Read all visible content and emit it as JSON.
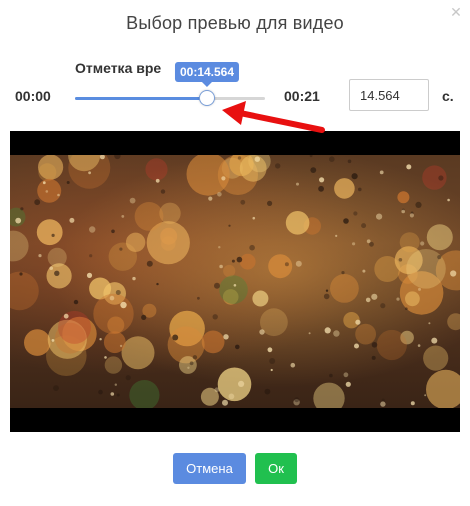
{
  "dialog": {
    "title": "Выбор превью для видео",
    "close_icon": "close-icon"
  },
  "timeline": {
    "label": "Отметка вре",
    "start_time": "00:00",
    "end_time": "00:21",
    "tooltip": "00:14.564",
    "position_fraction": 0.693,
    "seconds_value": "14.564",
    "seconds_unit": "с."
  },
  "annotation": {
    "arrow_color": "#e81010"
  },
  "buttons": {
    "cancel_label": "Отмена",
    "ok_label": "Ок"
  },
  "colors": {
    "accent": "#5b8be0",
    "ok": "#21c04f"
  }
}
